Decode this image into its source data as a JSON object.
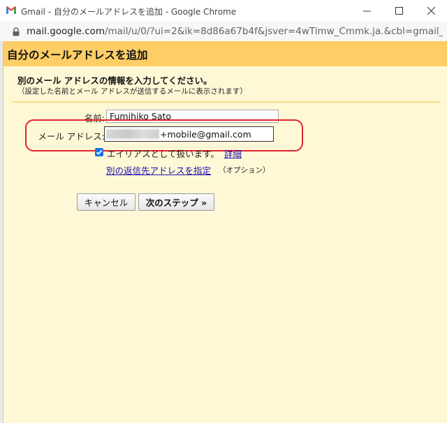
{
  "window": {
    "title": "Gmail - 自分のメールアドレスを追加 - Google Chrome",
    "url_host": "mail.google.com",
    "url_rest": "/mail/u/0/?ui=2&ik=8d86a67b4f&jsver=4wTimw_Cmmk.ja.&cbl=gmail_fe_..."
  },
  "dialog": {
    "title": "自分のメールアドレスを追加",
    "subtitle": "別のメール アドレスの情報を入力してください。",
    "note": "（設定した名前とメール アドレスが送信するメールに表示されます）",
    "name_label": "名前:",
    "name_value": "Fumihiko Sato",
    "email_label": "メール アドレス:",
    "email_value_visible": "+mobile@gmail.com",
    "alias_checkbox_label": "エイリアスとして扱います。",
    "alias_checked": true,
    "detail_link": "詳細",
    "reply_to_link": "別の返信先アドレスを指定",
    "reply_to_option": "（オプション）",
    "cancel_button": "キャンセル",
    "next_button": "次のステップ »"
  },
  "colors": {
    "header": "#fece66",
    "dialog_bg": "#fff8d7",
    "link": "#1a0dab",
    "highlight": "#e2232e",
    "checkbox": "#1a73e8"
  }
}
